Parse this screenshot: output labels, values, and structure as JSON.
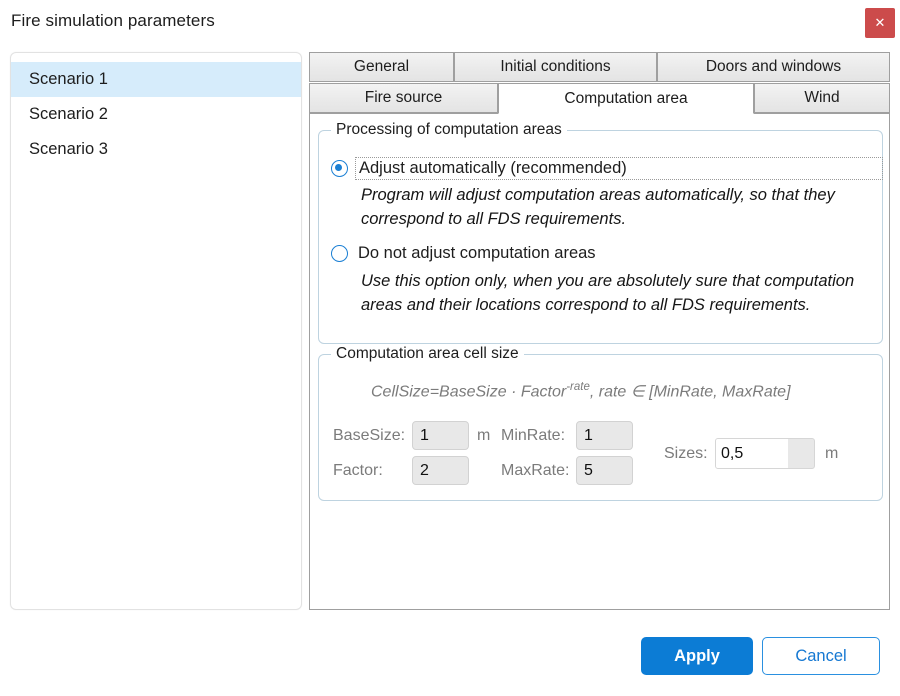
{
  "window": {
    "title": "Fire simulation parameters",
    "close_label": "✕"
  },
  "scenarios": {
    "items": [
      {
        "label": "Scenario 1",
        "selected": true
      },
      {
        "label": "Scenario 2",
        "selected": false
      },
      {
        "label": "Scenario 3",
        "selected": false
      }
    ]
  },
  "tabs": {
    "row1": [
      {
        "label": "General",
        "active": false
      },
      {
        "label": "Initial conditions",
        "active": false
      },
      {
        "label": "Doors and windows",
        "active": false
      }
    ],
    "row2": [
      {
        "label": "Fire source",
        "active": false
      },
      {
        "label": "Computation area",
        "active": true
      },
      {
        "label": "Wind",
        "active": false
      }
    ]
  },
  "processing_group": {
    "title": "Processing of computation areas",
    "option_auto": {
      "label": "Adjust automatically (recommended)",
      "checked": true,
      "focused": true,
      "hint": "Program will adjust computation areas automatically, so that they correspond to all FDS requirements."
    },
    "option_manual": {
      "label": "Do not adjust computation areas",
      "checked": false,
      "focused": false,
      "hint": "Use this option only, when you are absolutely sure that computation areas and their locations correspond to all FDS requirements."
    }
  },
  "cellsize_group": {
    "title": "Computation area cell size",
    "formula_part1": "CellSize=BaseSize · Factor",
    "formula_exponent": "-rate",
    "formula_part2": ", rate ∈ [MinRate, MaxRate]",
    "fields": {
      "basesize_label": "BaseSize:",
      "basesize_value": "1",
      "basesize_unit": "m",
      "factor_label": "Factor:",
      "factor_value": "2",
      "minrate_label": "MinRate:",
      "minrate_value": "1",
      "maxrate_label": "MaxRate:",
      "maxrate_value": "5",
      "sizes_label": "Sizes:",
      "sizes_value": "0,5",
      "sizes_unit": "m"
    }
  },
  "footer": {
    "apply_label": "Apply",
    "cancel_label": "Cancel"
  },
  "colors": {
    "accent": "#0c7cd5",
    "close": "#cc4b4b",
    "selection": "#d6ecfb",
    "group_border": "#bed3e0"
  }
}
